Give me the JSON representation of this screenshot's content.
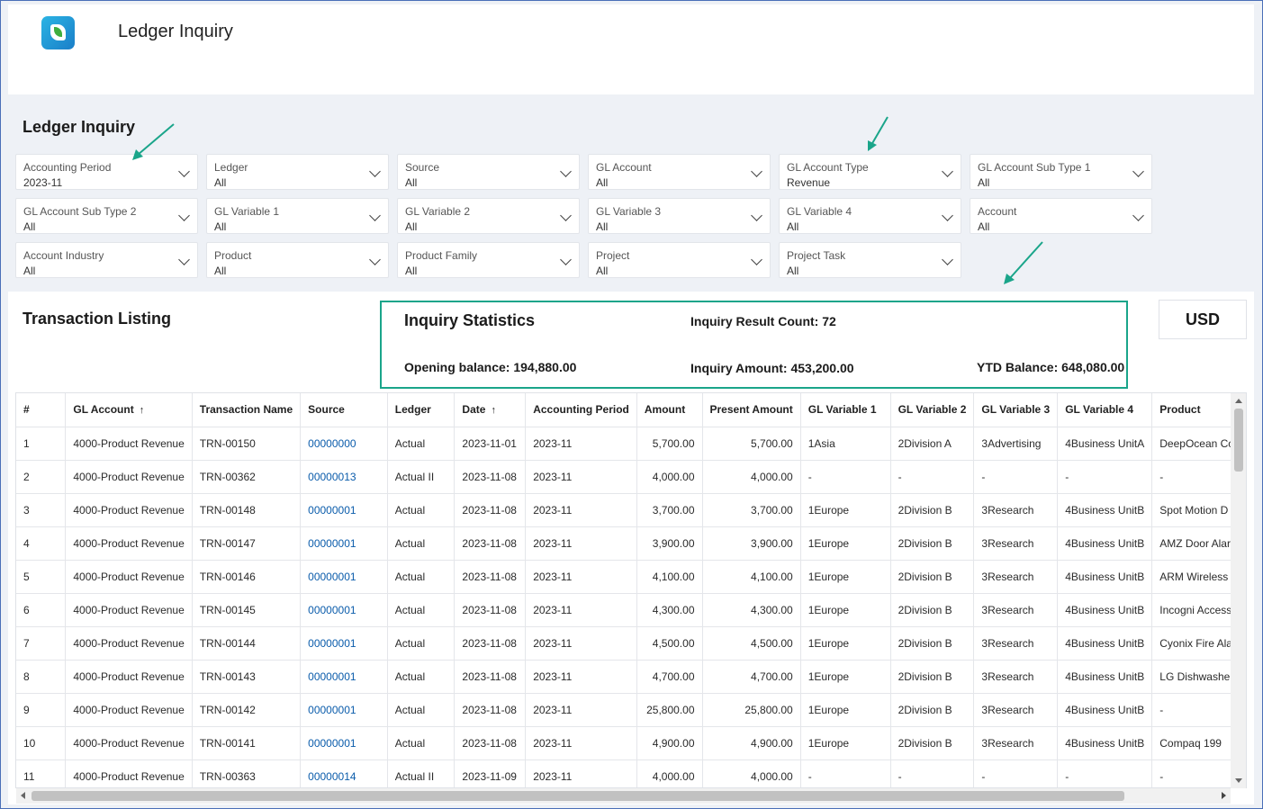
{
  "app": {
    "title": "Ledger Inquiry"
  },
  "filters_section": {
    "heading": "Ledger Inquiry",
    "filters": [
      {
        "label": "Accounting Period",
        "value": "2023-11"
      },
      {
        "label": "Ledger",
        "value": "All"
      },
      {
        "label": "Source",
        "value": "All"
      },
      {
        "label": "GL Account",
        "value": "All"
      },
      {
        "label": "GL Account Type",
        "value": "Revenue"
      },
      {
        "label": "GL Account Sub Type 1",
        "value": "All"
      },
      {
        "label": "GL Account Sub Type 2",
        "value": "All"
      },
      {
        "label": "GL Variable 1",
        "value": "All"
      },
      {
        "label": "GL Variable 2",
        "value": "All"
      },
      {
        "label": "GL Variable 3",
        "value": "All"
      },
      {
        "label": "GL Variable 4",
        "value": "All"
      },
      {
        "label": "Account",
        "value": "All"
      },
      {
        "label": "Account Industry",
        "value": "All"
      },
      {
        "label": "Product",
        "value": "All"
      },
      {
        "label": "Product Family",
        "value": "All"
      },
      {
        "label": "Project",
        "value": "All"
      },
      {
        "label": "Project Task",
        "value": "All"
      }
    ]
  },
  "listing": {
    "title": "Transaction Listing",
    "currency": "USD",
    "stats": {
      "title": "Inquiry Statistics",
      "result_count": "Inquiry Result Count: 72",
      "opening_balance": "Opening balance: 194,880.00",
      "inquiry_amount": "Inquiry Amount: 453,200.00",
      "ytd_balance": "YTD Balance: 648,080.00"
    },
    "columns": [
      "#",
      "GL Account",
      "Transaction Name",
      "Source",
      "Ledger",
      "Date",
      "Accounting Period",
      "Amount",
      "Present Amount",
      "GL Variable 1",
      "GL Variable 2",
      "GL Variable 3",
      "GL Variable 4",
      "Product"
    ],
    "sorted_columns": [
      "GL Account",
      "Date"
    ],
    "rows": [
      [
        "1",
        "4000-Product Revenue",
        "TRN-00150",
        "00000000",
        "Actual",
        "2023-11-01",
        "2023-11",
        "5,700.00",
        "5,700.00",
        "1Asia",
        "2Division A",
        "3Advertising",
        "4Business UnitA",
        "DeepOcean Cc"
      ],
      [
        "2",
        "4000-Product Revenue",
        "TRN-00362",
        "00000013",
        "Actual II",
        "2023-11-08",
        "2023-11",
        "4,000.00",
        "4,000.00",
        "-",
        "-",
        "-",
        "-",
        "-"
      ],
      [
        "3",
        "4000-Product Revenue",
        "TRN-00148",
        "00000001",
        "Actual",
        "2023-11-08",
        "2023-11",
        "3,700.00",
        "3,700.00",
        "1Europe",
        "2Division B",
        "3Research",
        "4Business UnitB",
        "Spot Motion D"
      ],
      [
        "4",
        "4000-Product Revenue",
        "TRN-00147",
        "00000001",
        "Actual",
        "2023-11-08",
        "2023-11",
        "3,900.00",
        "3,900.00",
        "1Europe",
        "2Division B",
        "3Research",
        "4Business UnitB",
        "AMZ Door Alar"
      ],
      [
        "5",
        "4000-Product Revenue",
        "TRN-00146",
        "00000001",
        "Actual",
        "2023-11-08",
        "2023-11",
        "4,100.00",
        "4,100.00",
        "1Europe",
        "2Division B",
        "3Research",
        "4Business UnitB",
        "ARM Wireless A"
      ],
      [
        "6",
        "4000-Product Revenue",
        "TRN-00145",
        "00000001",
        "Actual",
        "2023-11-08",
        "2023-11",
        "4,300.00",
        "4,300.00",
        "1Europe",
        "2Division B",
        "3Research",
        "4Business UnitB",
        "Incogni Access"
      ],
      [
        "7",
        "4000-Product Revenue",
        "TRN-00144",
        "00000001",
        "Actual",
        "2023-11-08",
        "2023-11",
        "4,500.00",
        "4,500.00",
        "1Europe",
        "2Division B",
        "3Research",
        "4Business UnitB",
        "Cyonix Fire Ala"
      ],
      [
        "8",
        "4000-Product Revenue",
        "TRN-00143",
        "00000001",
        "Actual",
        "2023-11-08",
        "2023-11",
        "4,700.00",
        "4,700.00",
        "1Europe",
        "2Division B",
        "3Research",
        "4Business UnitB",
        "LG Dishwasher"
      ],
      [
        "9",
        "4000-Product Revenue",
        "TRN-00142",
        "00000001",
        "Actual",
        "2023-11-08",
        "2023-11",
        "25,800.00",
        "25,800.00",
        "1Europe",
        "2Division B",
        "3Research",
        "4Business UnitB",
        "-"
      ],
      [
        "10",
        "4000-Product Revenue",
        "TRN-00141",
        "00000001",
        "Actual",
        "2023-11-08",
        "2023-11",
        "4,900.00",
        "4,900.00",
        "1Europe",
        "2Division B",
        "3Research",
        "4Business UnitB",
        "Compaq 199"
      ],
      [
        "11",
        "4000-Product Revenue",
        "TRN-00363",
        "00000014",
        "Actual II",
        "2023-11-09",
        "2023-11",
        "4,000.00",
        "4,000.00",
        "-",
        "-",
        "-",
        "-",
        "-"
      ]
    ]
  },
  "colors": {
    "accent_border": "#1aa58a",
    "link": "#0b5cab",
    "frame_border": "#4a6fb8"
  },
  "icons": {
    "logo": "app-logo-icon",
    "dropdown": "chevron-down-icon",
    "sort": "arrow-up-icon"
  }
}
